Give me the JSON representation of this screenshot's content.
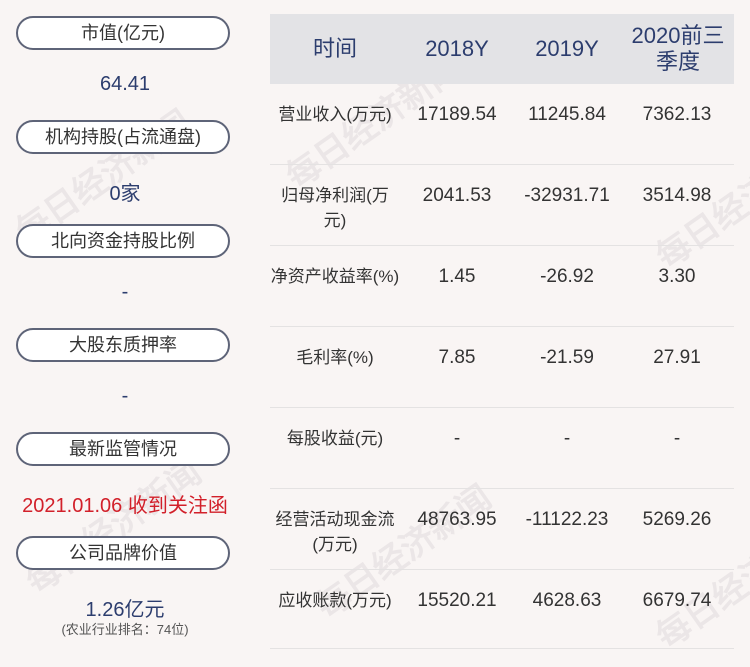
{
  "left_panel": {
    "market_cap": {
      "label": "市值(亿元)",
      "value": "64.41"
    },
    "institution": {
      "label": "机构持股(占流通盘)",
      "value": "0家"
    },
    "northbound": {
      "label": "北向资金持股比例",
      "value": "-"
    },
    "pledge": {
      "label": "大股东质押率",
      "value": "-"
    },
    "supervision": {
      "label": "最新监管情况",
      "value": "2021.01.06 收到关注函"
    },
    "brand": {
      "label": "公司品牌价值",
      "value": "1.26亿元",
      "note": "(农业行业排名：74位)"
    }
  },
  "table": {
    "headers": [
      "时间",
      "2018Y",
      "2019Y",
      "2020前三季度"
    ],
    "rows": [
      {
        "label": "营业收入(万元)",
        "v2018": "17189.54",
        "v2019": "11245.84",
        "v2020": "7362.13"
      },
      {
        "label": "归母净利润(万元)",
        "v2018": "2041.53",
        "v2019": "-32931.71",
        "v2020": "3514.98"
      },
      {
        "label": "净资产收益率(%)",
        "v2018": "1.45",
        "v2019": "-26.92",
        "v2020": "3.30"
      },
      {
        "label": "毛利率(%)",
        "v2018": "7.85",
        "v2019": "-21.59",
        "v2020": "27.91"
      },
      {
        "label": "每股收益(元)",
        "v2018": "-",
        "v2019": "-",
        "v2020": "-"
      },
      {
        "label": "经营活动现金流(万元)",
        "v2018": "48763.95",
        "v2019": "-11122.23",
        "v2020": "5269.26"
      },
      {
        "label": "应收账款(万元)",
        "v2018": "15520.21",
        "v2019": "4628.63",
        "v2020": "6679.74"
      }
    ]
  },
  "watermark": "每日经济新闻",
  "colors": {
    "accent": "#2c3d6e",
    "alert": "#d2202a",
    "header_bg": "#e3e3e6",
    "background": "#f9f5f4"
  }
}
